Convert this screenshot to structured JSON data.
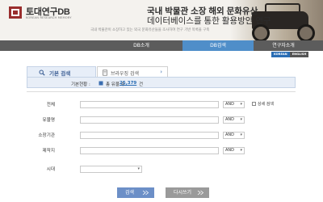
{
  "brand": {
    "name": "토대연구DB",
    "subtitle": "KOREAN RESEARCH MEMORY"
  },
  "header": {
    "title_line1": "국내 박물관 소장 해외 문화유산",
    "title_line2": "데이터베이스를 통한 활용방안 연구",
    "tagline": "국내 박물관이 소장하고 있는 외국 문화유산들을 조사하여 연구 기반 목록을 구축"
  },
  "nav": {
    "items": [
      {
        "label": "DB소개"
      },
      {
        "label": "DB검색"
      },
      {
        "label": "연구자소개"
      }
    ],
    "active_color": "#4f8ec9"
  },
  "lang": {
    "korean": "KOREAN",
    "english": "ENGLISH"
  },
  "tabs": {
    "basic_search": "기본 검색",
    "browse_search": "브라우징 검색"
  },
  "count": {
    "label": "기본현황 :",
    "prefix": "총 유물 수",
    "value": "25,379",
    "unit": "건"
  },
  "form": {
    "rows": [
      {
        "label": "전체",
        "operator": "AND"
      },
      {
        "label": "유물명",
        "operator": "AND"
      },
      {
        "label": "소장기관",
        "operator": "AND"
      },
      {
        "label": "제작지",
        "operator": "AND"
      },
      {
        "label": "시대",
        "operator": ""
      }
    ],
    "checkbox_label": "상세 검색"
  },
  "buttons": {
    "search": "검색",
    "reset": "다시쓰기"
  },
  "icons": {
    "logo": "logo-icon",
    "search_tab": "magnifier-icon",
    "browse_tab": "document-icon",
    "count": "box-icon",
    "dropdown": "chevron-down-icon",
    "tab_chevron": "chevron-right-icon"
  }
}
